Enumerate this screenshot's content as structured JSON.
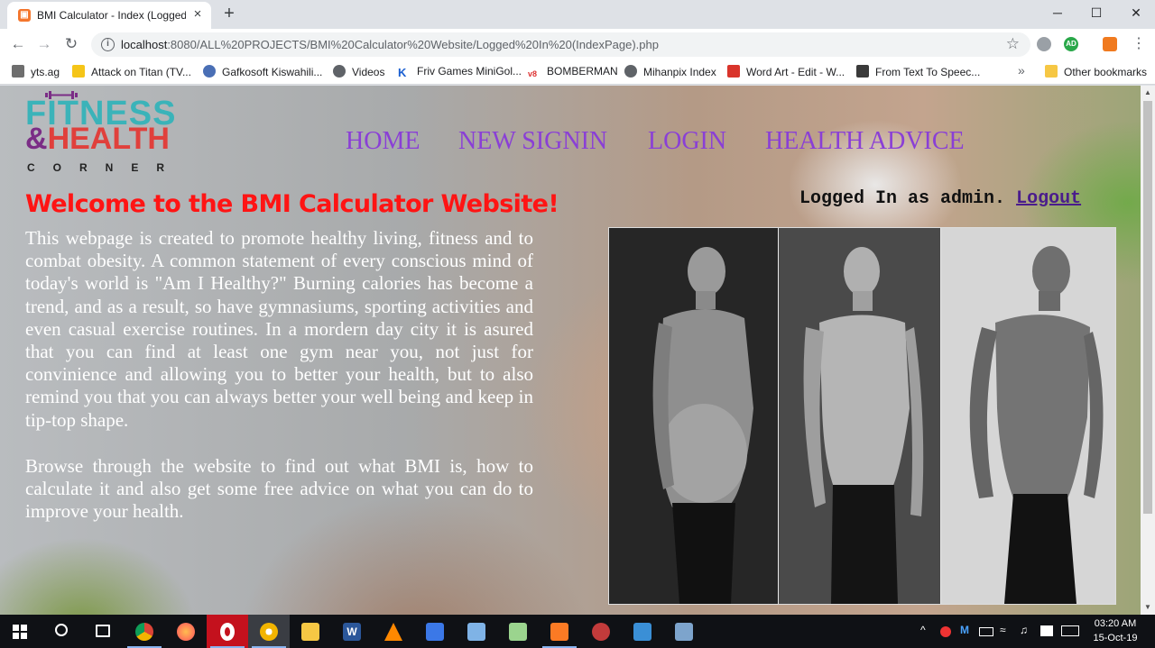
{
  "browser": {
    "tab_title": "BMI Calculator - Index (Logged In)",
    "url_host": "localhost",
    "url_rest": ":8080/ALL%20PROJECTS/BMI%20Calculator%20Website/Logged%20In%20(IndexPage).php",
    "profile_badge": "AD",
    "window_controls": {
      "minimize": "─",
      "maximize": "☐",
      "close": "✕"
    }
  },
  "bookmarks": [
    {
      "label": "yts.ag",
      "icon": "yts-icon",
      "color": "#6e6e6e"
    },
    {
      "label": "Attack on Titan (TV...",
      "icon": "imdb-icon",
      "color": "#f5c518"
    },
    {
      "label": "Gafkosoft Kiswahili...",
      "icon": "globe-icon",
      "color": "#4a6fb5"
    },
    {
      "label": "Videos",
      "icon": "globe-icon",
      "color": "#5f6368"
    },
    {
      "label": "Friv Games MiniGol...",
      "icon": "k-icon",
      "color": "#1a5fd1"
    },
    {
      "label": "BOMBERMAN",
      "icon": "v8-icon",
      "color": "#d33"
    },
    {
      "label": "Mihanpix Index",
      "icon": "globe-icon",
      "color": "#5f6368"
    },
    {
      "label": "Word Art - Edit - W...",
      "icon": "wordart-icon",
      "color": "#d9342b"
    },
    {
      "label": "From Text To Speec...",
      "icon": "speech-icon",
      "color": "#3a3a3a"
    }
  ],
  "bookmarks_more": "»",
  "other_bookmarks": "Other bookmarks",
  "logo": {
    "line1": "FITNESS",
    "amp": "&",
    "line2": "HEALTH",
    "line3": "CORNER"
  },
  "nav": [
    "HOME",
    "NEW SIGNIN",
    "LOGIN",
    "HEALTH ADVICE"
  ],
  "status": {
    "prefix": "Logged In as admin.",
    "logout": "Logout"
  },
  "welcome": "Welcome to the BMI Calculator Website!",
  "paragraphs": [
    "This webpage is created to promote healthy living, fitness and to combat obesity. A common statement of every conscious mind of today's world is \"Am I Healthy?\" Burning calories has become a trend, and as a result, so have gymnasiums, sporting activities and even casual exercise routines. In a mordern day city it is asured that you can find at least one gym near you, not just for convinience and allowing you to better your health, but to also remind you that you can always better your well being and keep in tip-top shape.",
    "Browse through the website to find out what BMI is, how to calculate it and also get some free advice on what you can do to improve your health."
  ],
  "taskbar": {
    "apps": [
      {
        "name": "search",
        "color": "#0f1115"
      },
      {
        "name": "task-view",
        "color": "#0f1115"
      },
      {
        "name": "chrome",
        "color": "#4285f4"
      },
      {
        "name": "firefox",
        "color": "#ff7139"
      },
      {
        "name": "opera",
        "color": "#d6091d"
      },
      {
        "name": "chrome-canary",
        "color": "#f2b400"
      },
      {
        "name": "file-explorer",
        "color": "#f6c744"
      },
      {
        "name": "word",
        "color": "#2b579a"
      },
      {
        "name": "vlc",
        "color": "#ff8800"
      },
      {
        "name": "settings-app",
        "color": "#3b78e7"
      },
      {
        "name": "box-app",
        "color": "#7fb3e6"
      },
      {
        "name": "folder-app",
        "color": "#9bd48e"
      },
      {
        "name": "xampp",
        "color": "#fb7a24"
      },
      {
        "name": "uget",
        "color": "#c23b3b"
      },
      {
        "name": "remote-app",
        "color": "#3a8fd6"
      },
      {
        "name": "image-app",
        "color": "#7da4cc"
      }
    ],
    "time": "03:20 AM",
    "date": "15-Oct-19",
    "tray_up": "^"
  }
}
